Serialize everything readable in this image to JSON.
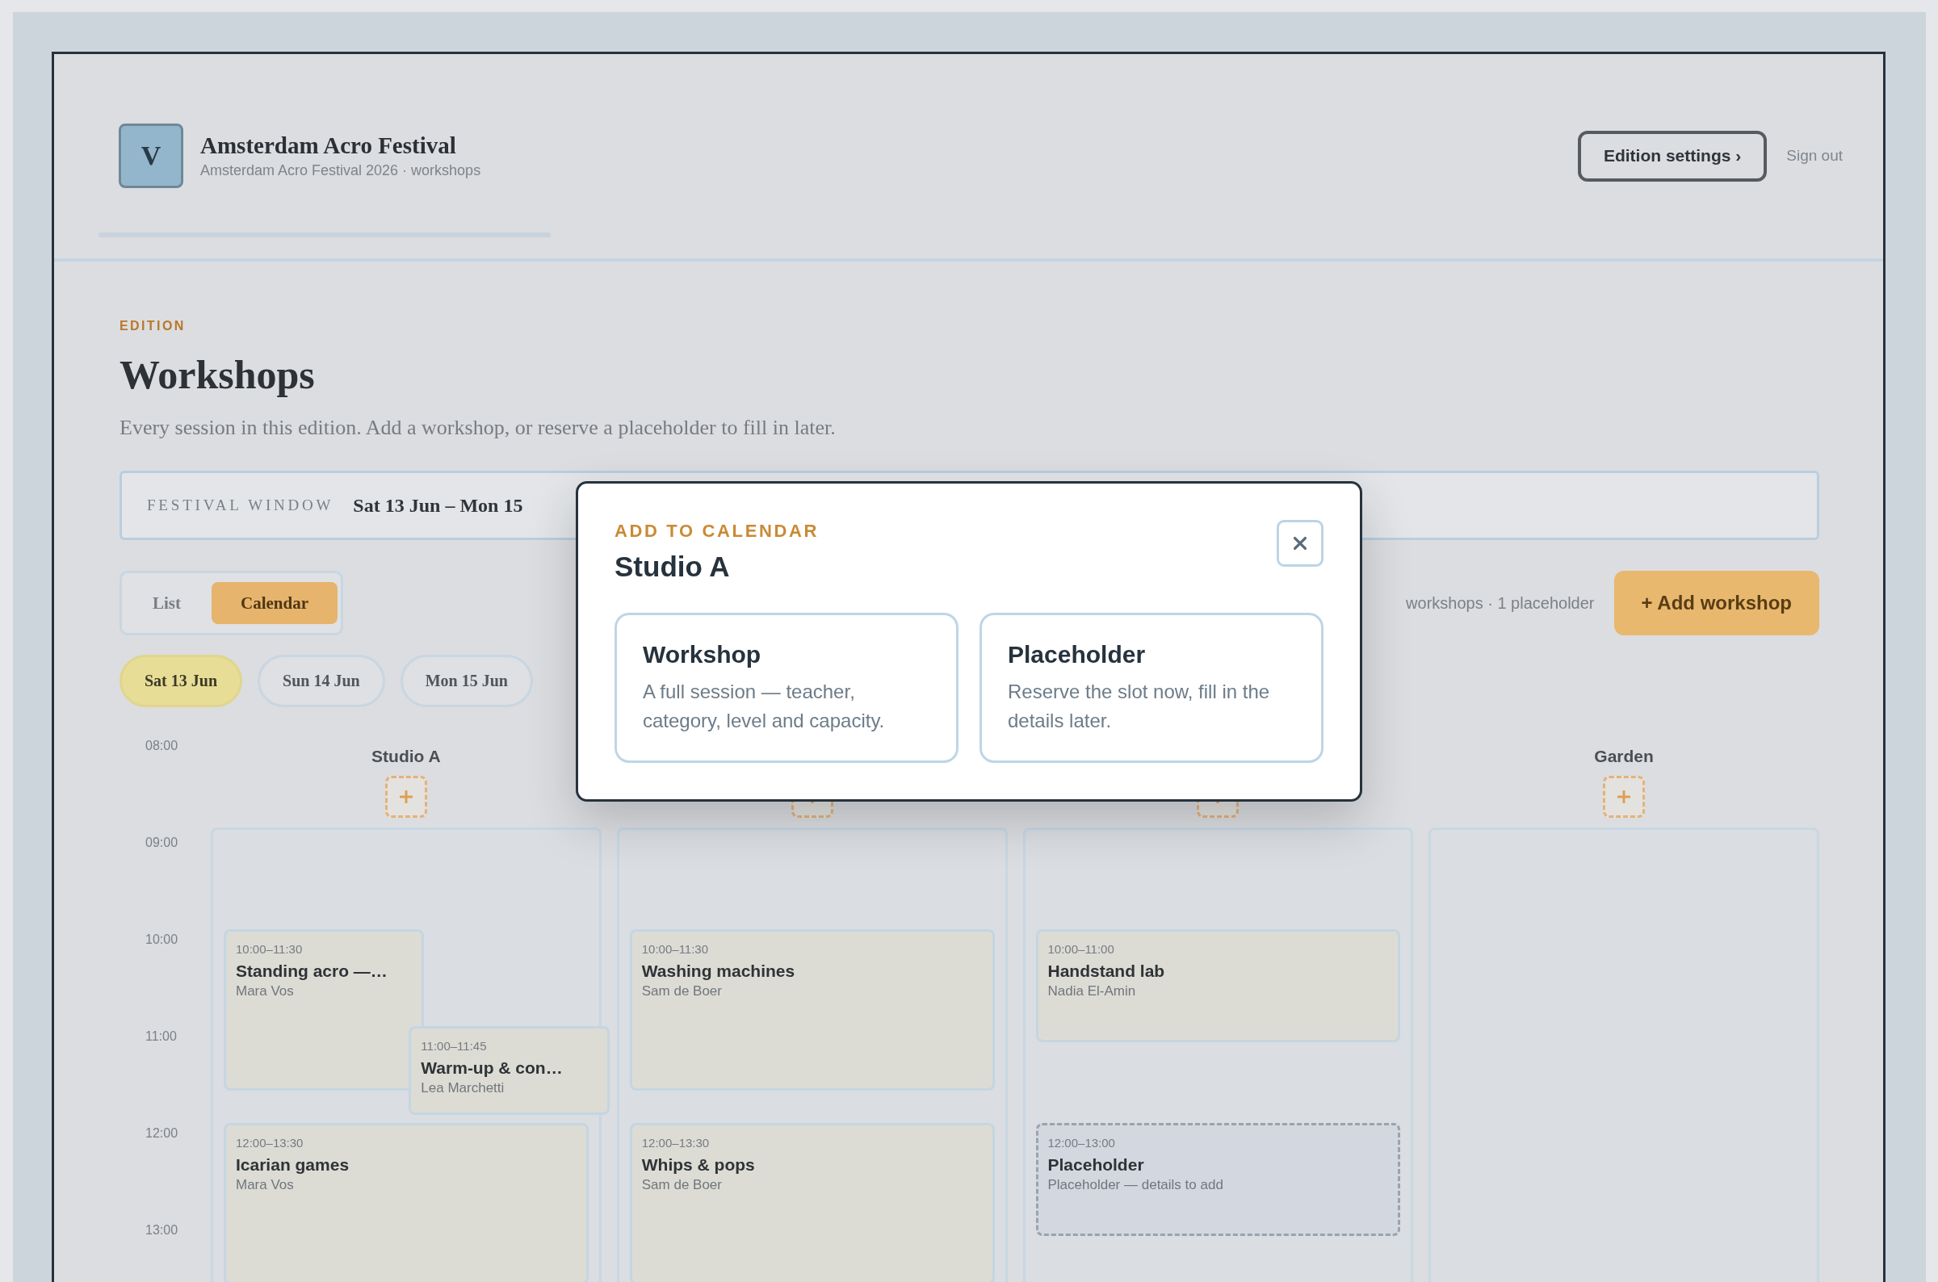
{
  "header": {
    "logo_letter": "V",
    "title": "Amsterdam Acro Festival",
    "subtitle": "Amsterdam Acro Festival 2026 · workshops",
    "settings_button": "Edition settings ›",
    "sign_out": "Sign out"
  },
  "page": {
    "eyebrow": "EDITION",
    "title": "Workshops",
    "description": "Every session in this edition. Add a workshop, or reserve a placeholder to fill in later."
  },
  "festival_window": {
    "label": "FESTIVAL WINDOW",
    "value": "Sat 13 Jun – Mon 15"
  },
  "view_tabs": [
    {
      "label": "List",
      "selected": false
    },
    {
      "label": "Calendar",
      "selected": true
    }
  ],
  "summary": "workshops · 1 placeholder",
  "add_button": "+ Add workshop",
  "days": [
    {
      "label": "Sat 13 Jun",
      "selected": true
    },
    {
      "label": "Sun 14 Jun",
      "selected": false
    },
    {
      "label": "Mon 15 Jun",
      "selected": false
    }
  ],
  "calendar": {
    "hours": [
      "08:00",
      "09:00",
      "10:00",
      "11:00",
      "12:00",
      "13:00"
    ],
    "columns": [
      {
        "name": "Studio A",
        "events": [
          {
            "kind": "workshop",
            "time": "10:00–11:30",
            "title": "Standing acro —…",
            "subtitle": "Mara Vos"
          },
          {
            "kind": "workshop",
            "time": "11:00–11:45",
            "title": "Warm-up & con…",
            "subtitle": "Lea Marchetti"
          },
          {
            "kind": "workshop",
            "time": "12:00–13:30",
            "title": "Icarian games",
            "subtitle": "Mara Vos"
          }
        ]
      },
      {
        "events": [
          {
            "kind": "workshop",
            "time": "10:00–11:30",
            "title": "Washing machines",
            "subtitle": "Sam de Boer"
          },
          {
            "kind": "workshop",
            "time": "12:00–13:30",
            "title": "Whips & pops",
            "subtitle": "Sam de Boer"
          }
        ]
      },
      {
        "events": [
          {
            "kind": "workshop",
            "time": "10:00–11:00",
            "title": "Handstand lab",
            "subtitle": "Nadia El-Amin"
          },
          {
            "kind": "placeholder",
            "time": "12:00–13:00",
            "title": "Placeholder",
            "subtitle": "Placeholder — details to add"
          }
        ]
      },
      {
        "name": "Garden"
      }
    ]
  },
  "modal": {
    "eyebrow": "ADD TO CALENDAR",
    "title": "Studio A",
    "options": [
      {
        "title": "Workshop",
        "description": "A full session — teacher, category, level and capacity."
      },
      {
        "title": "Placeholder",
        "description": "Reserve the slot now, fill in the details later."
      }
    ]
  }
}
